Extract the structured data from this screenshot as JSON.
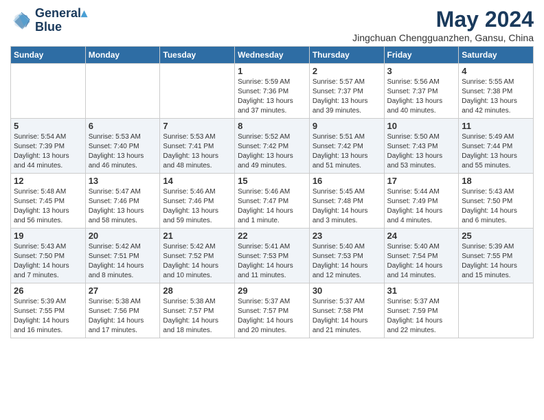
{
  "header": {
    "logo_line1": "General",
    "logo_line2": "Blue",
    "title": "May 2024",
    "subtitle": "Jingchuan Chengguanzhen, Gansu, China"
  },
  "days_of_week": [
    "Sunday",
    "Monday",
    "Tuesday",
    "Wednesday",
    "Thursday",
    "Friday",
    "Saturday"
  ],
  "weeks": [
    {
      "shade": "white",
      "days": [
        {
          "num": "",
          "info": ""
        },
        {
          "num": "",
          "info": ""
        },
        {
          "num": "",
          "info": ""
        },
        {
          "num": "1",
          "info": "Sunrise: 5:59 AM\nSunset: 7:36 PM\nDaylight: 13 hours\nand 37 minutes."
        },
        {
          "num": "2",
          "info": "Sunrise: 5:57 AM\nSunset: 7:37 PM\nDaylight: 13 hours\nand 39 minutes."
        },
        {
          "num": "3",
          "info": "Sunrise: 5:56 AM\nSunset: 7:37 PM\nDaylight: 13 hours\nand 40 minutes."
        },
        {
          "num": "4",
          "info": "Sunrise: 5:55 AM\nSunset: 7:38 PM\nDaylight: 13 hours\nand 42 minutes."
        }
      ]
    },
    {
      "shade": "shaded",
      "days": [
        {
          "num": "5",
          "info": "Sunrise: 5:54 AM\nSunset: 7:39 PM\nDaylight: 13 hours\nand 44 minutes."
        },
        {
          "num": "6",
          "info": "Sunrise: 5:53 AM\nSunset: 7:40 PM\nDaylight: 13 hours\nand 46 minutes."
        },
        {
          "num": "7",
          "info": "Sunrise: 5:53 AM\nSunset: 7:41 PM\nDaylight: 13 hours\nand 48 minutes."
        },
        {
          "num": "8",
          "info": "Sunrise: 5:52 AM\nSunset: 7:42 PM\nDaylight: 13 hours\nand 49 minutes."
        },
        {
          "num": "9",
          "info": "Sunrise: 5:51 AM\nSunset: 7:42 PM\nDaylight: 13 hours\nand 51 minutes."
        },
        {
          "num": "10",
          "info": "Sunrise: 5:50 AM\nSunset: 7:43 PM\nDaylight: 13 hours\nand 53 minutes."
        },
        {
          "num": "11",
          "info": "Sunrise: 5:49 AM\nSunset: 7:44 PM\nDaylight: 13 hours\nand 55 minutes."
        }
      ]
    },
    {
      "shade": "white",
      "days": [
        {
          "num": "12",
          "info": "Sunrise: 5:48 AM\nSunset: 7:45 PM\nDaylight: 13 hours\nand 56 minutes."
        },
        {
          "num": "13",
          "info": "Sunrise: 5:47 AM\nSunset: 7:46 PM\nDaylight: 13 hours\nand 58 minutes."
        },
        {
          "num": "14",
          "info": "Sunrise: 5:46 AM\nSunset: 7:46 PM\nDaylight: 13 hours\nand 59 minutes."
        },
        {
          "num": "15",
          "info": "Sunrise: 5:46 AM\nSunset: 7:47 PM\nDaylight: 14 hours\nand 1 minute."
        },
        {
          "num": "16",
          "info": "Sunrise: 5:45 AM\nSunset: 7:48 PM\nDaylight: 14 hours\nand 3 minutes."
        },
        {
          "num": "17",
          "info": "Sunrise: 5:44 AM\nSunset: 7:49 PM\nDaylight: 14 hours\nand 4 minutes."
        },
        {
          "num": "18",
          "info": "Sunrise: 5:43 AM\nSunset: 7:50 PM\nDaylight: 14 hours\nand 6 minutes."
        }
      ]
    },
    {
      "shade": "shaded",
      "days": [
        {
          "num": "19",
          "info": "Sunrise: 5:43 AM\nSunset: 7:50 PM\nDaylight: 14 hours\nand 7 minutes."
        },
        {
          "num": "20",
          "info": "Sunrise: 5:42 AM\nSunset: 7:51 PM\nDaylight: 14 hours\nand 8 minutes."
        },
        {
          "num": "21",
          "info": "Sunrise: 5:42 AM\nSunset: 7:52 PM\nDaylight: 14 hours\nand 10 minutes."
        },
        {
          "num": "22",
          "info": "Sunrise: 5:41 AM\nSunset: 7:53 PM\nDaylight: 14 hours\nand 11 minutes."
        },
        {
          "num": "23",
          "info": "Sunrise: 5:40 AM\nSunset: 7:53 PM\nDaylight: 14 hours\nand 12 minutes."
        },
        {
          "num": "24",
          "info": "Sunrise: 5:40 AM\nSunset: 7:54 PM\nDaylight: 14 hours\nand 14 minutes."
        },
        {
          "num": "25",
          "info": "Sunrise: 5:39 AM\nSunset: 7:55 PM\nDaylight: 14 hours\nand 15 minutes."
        }
      ]
    },
    {
      "shade": "white",
      "days": [
        {
          "num": "26",
          "info": "Sunrise: 5:39 AM\nSunset: 7:55 PM\nDaylight: 14 hours\nand 16 minutes."
        },
        {
          "num": "27",
          "info": "Sunrise: 5:38 AM\nSunset: 7:56 PM\nDaylight: 14 hours\nand 17 minutes."
        },
        {
          "num": "28",
          "info": "Sunrise: 5:38 AM\nSunset: 7:57 PM\nDaylight: 14 hours\nand 18 minutes."
        },
        {
          "num": "29",
          "info": "Sunrise: 5:37 AM\nSunset: 7:57 PM\nDaylight: 14 hours\nand 20 minutes."
        },
        {
          "num": "30",
          "info": "Sunrise: 5:37 AM\nSunset: 7:58 PM\nDaylight: 14 hours\nand 21 minutes."
        },
        {
          "num": "31",
          "info": "Sunrise: 5:37 AM\nSunset: 7:59 PM\nDaylight: 14 hours\nand 22 minutes."
        },
        {
          "num": "",
          "info": ""
        }
      ]
    }
  ]
}
